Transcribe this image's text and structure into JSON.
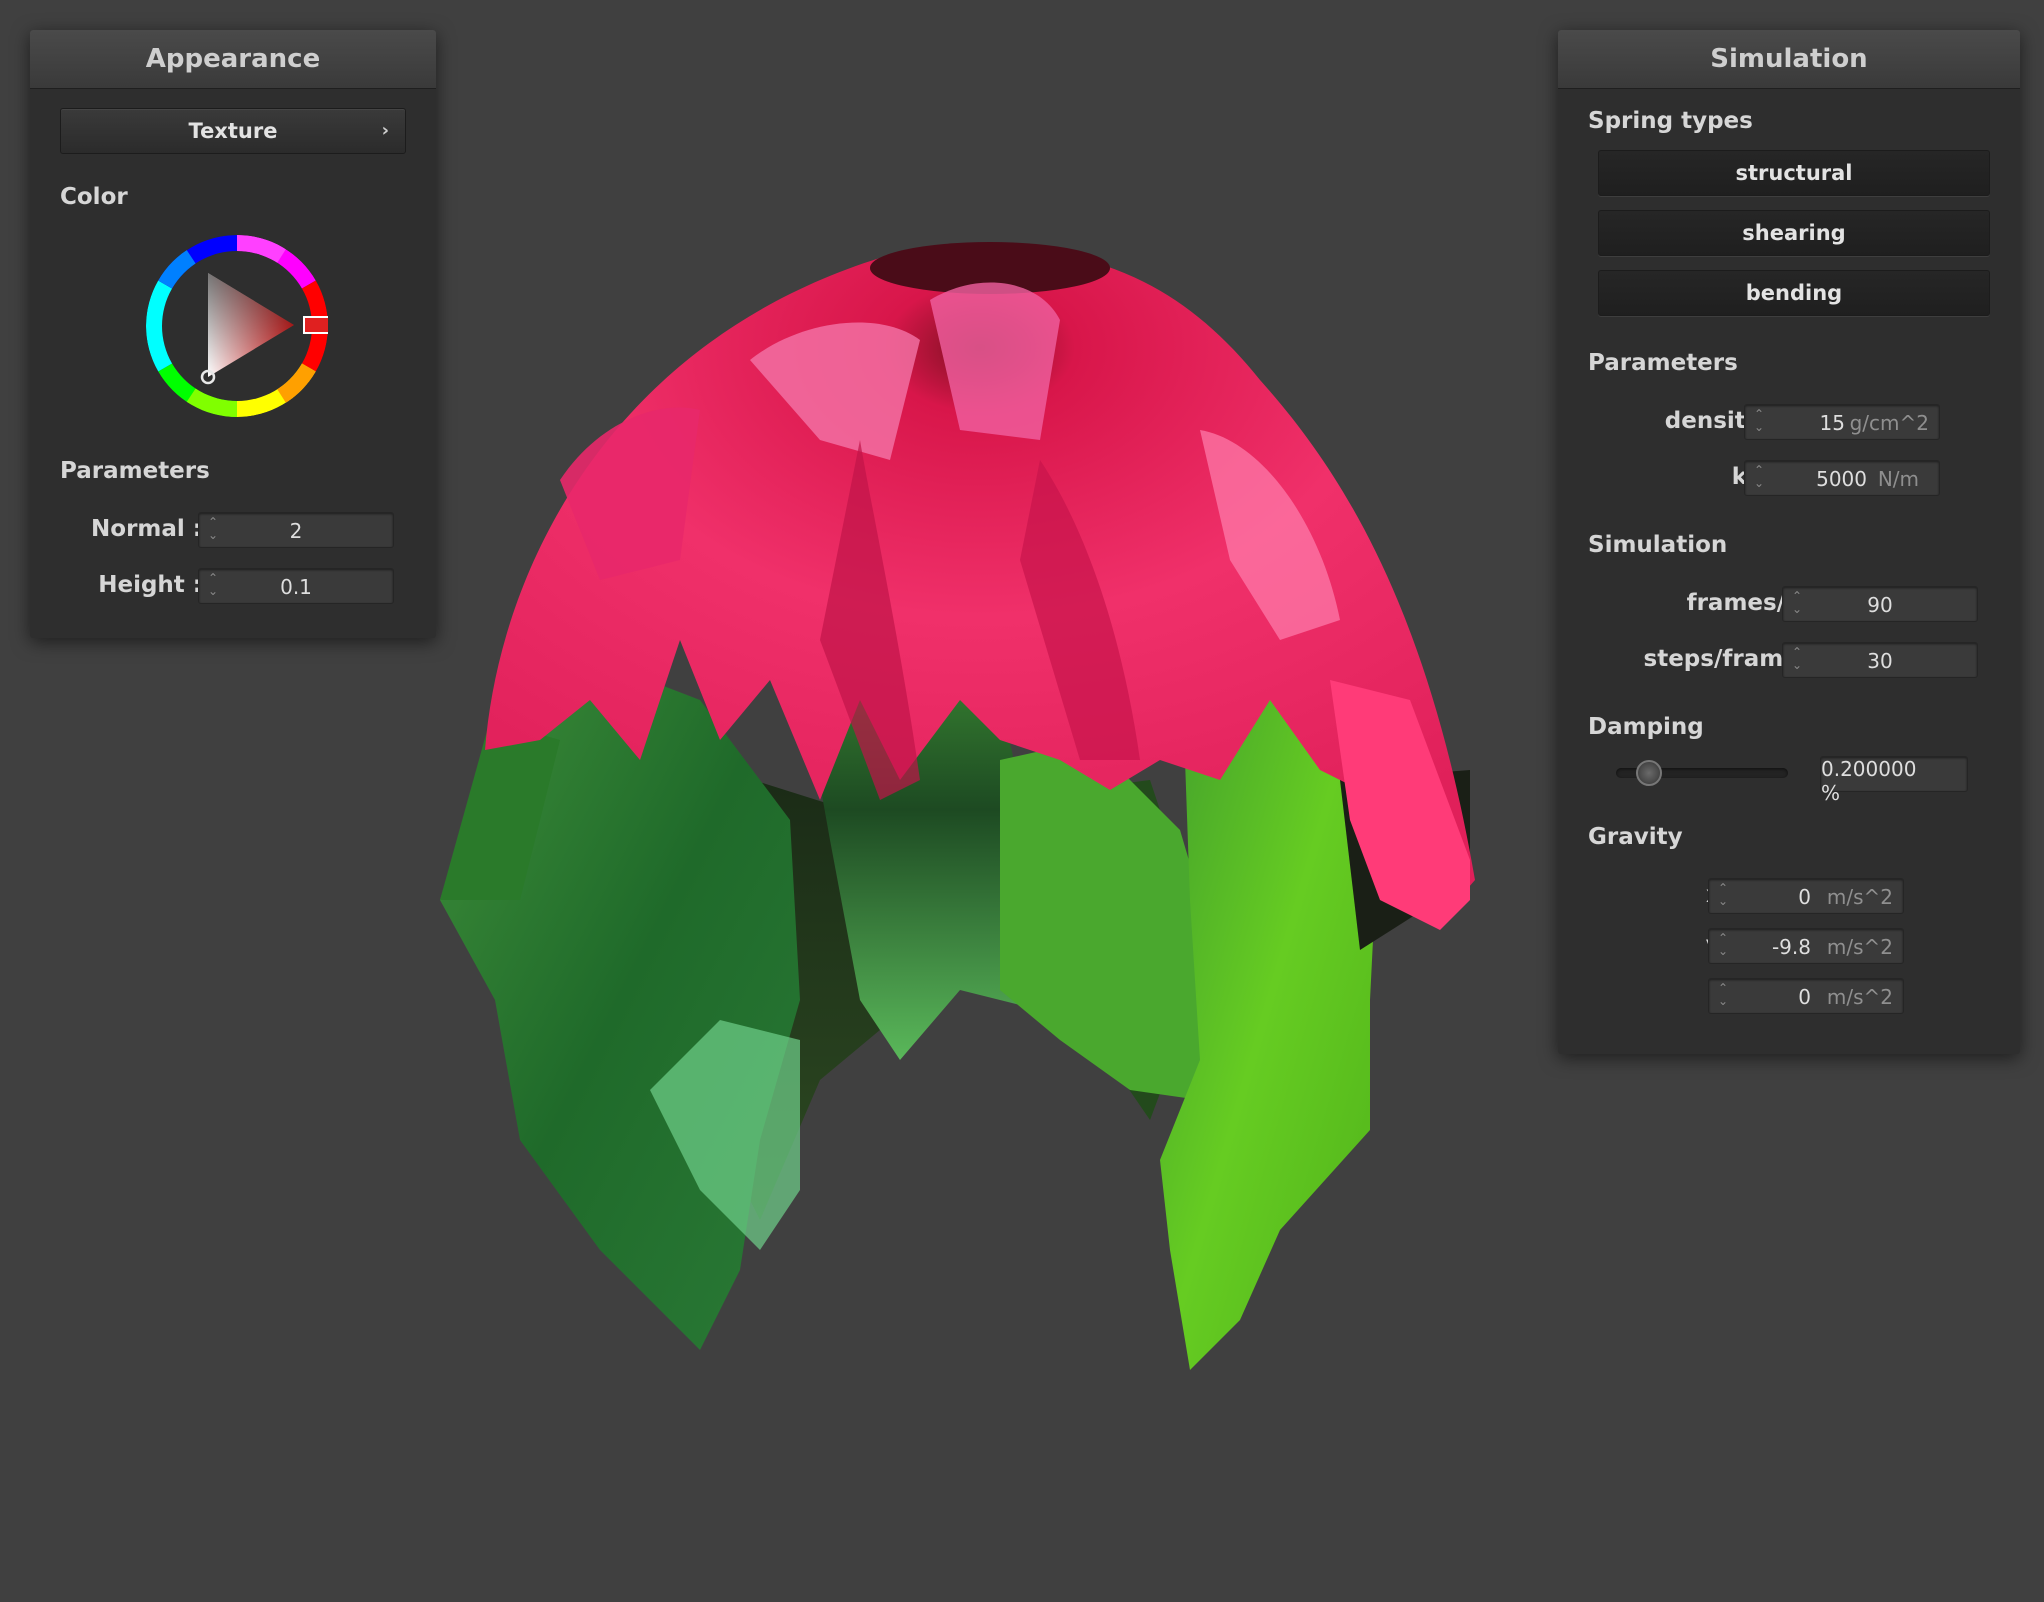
{
  "appearance": {
    "title": "Appearance",
    "texture_button": "Texture",
    "texture_chevron": "›",
    "color_label": "Color",
    "parameters_label": "Parameters",
    "normal": {
      "label": "Normal :",
      "value": "2"
    },
    "height": {
      "label": "Height :",
      "value": "0.1"
    },
    "color_value": "#e02020"
  },
  "simulation_panel": {
    "title": "Simulation",
    "spring_types_label": "Spring types",
    "spring_types": [
      "structural",
      "shearing",
      "bending"
    ],
    "parameters_label": "Parameters",
    "density": {
      "label": "density :",
      "value": "15",
      "unit": "g/cm^2"
    },
    "ks": {
      "label": "ks :",
      "value": "5000",
      "unit": "N/m"
    },
    "simulation_label": "Simulation",
    "frames_per_s": {
      "label": "frames/s :",
      "value": "90"
    },
    "steps_per_frame": {
      "label": "steps/frame :",
      "value": "30"
    },
    "damping_label": "Damping",
    "damping": {
      "value": "0.200000",
      "unit": "%",
      "slider_fraction": 0.2
    },
    "gravity_label": "Gravity",
    "gravity": [
      {
        "label": "x :",
        "value": "0",
        "unit": "m/s^2"
      },
      {
        "label": "y :",
        "value": "-9.8",
        "unit": "m/s^2"
      },
      {
        "label": "z :",
        "value": "0",
        "unit": "m/s^2"
      }
    ]
  },
  "colors": {
    "background": "#404040",
    "petal_pink": "#e8205a",
    "leaf_green": "#2f8a3a",
    "bright_green": "#6ad81e"
  }
}
